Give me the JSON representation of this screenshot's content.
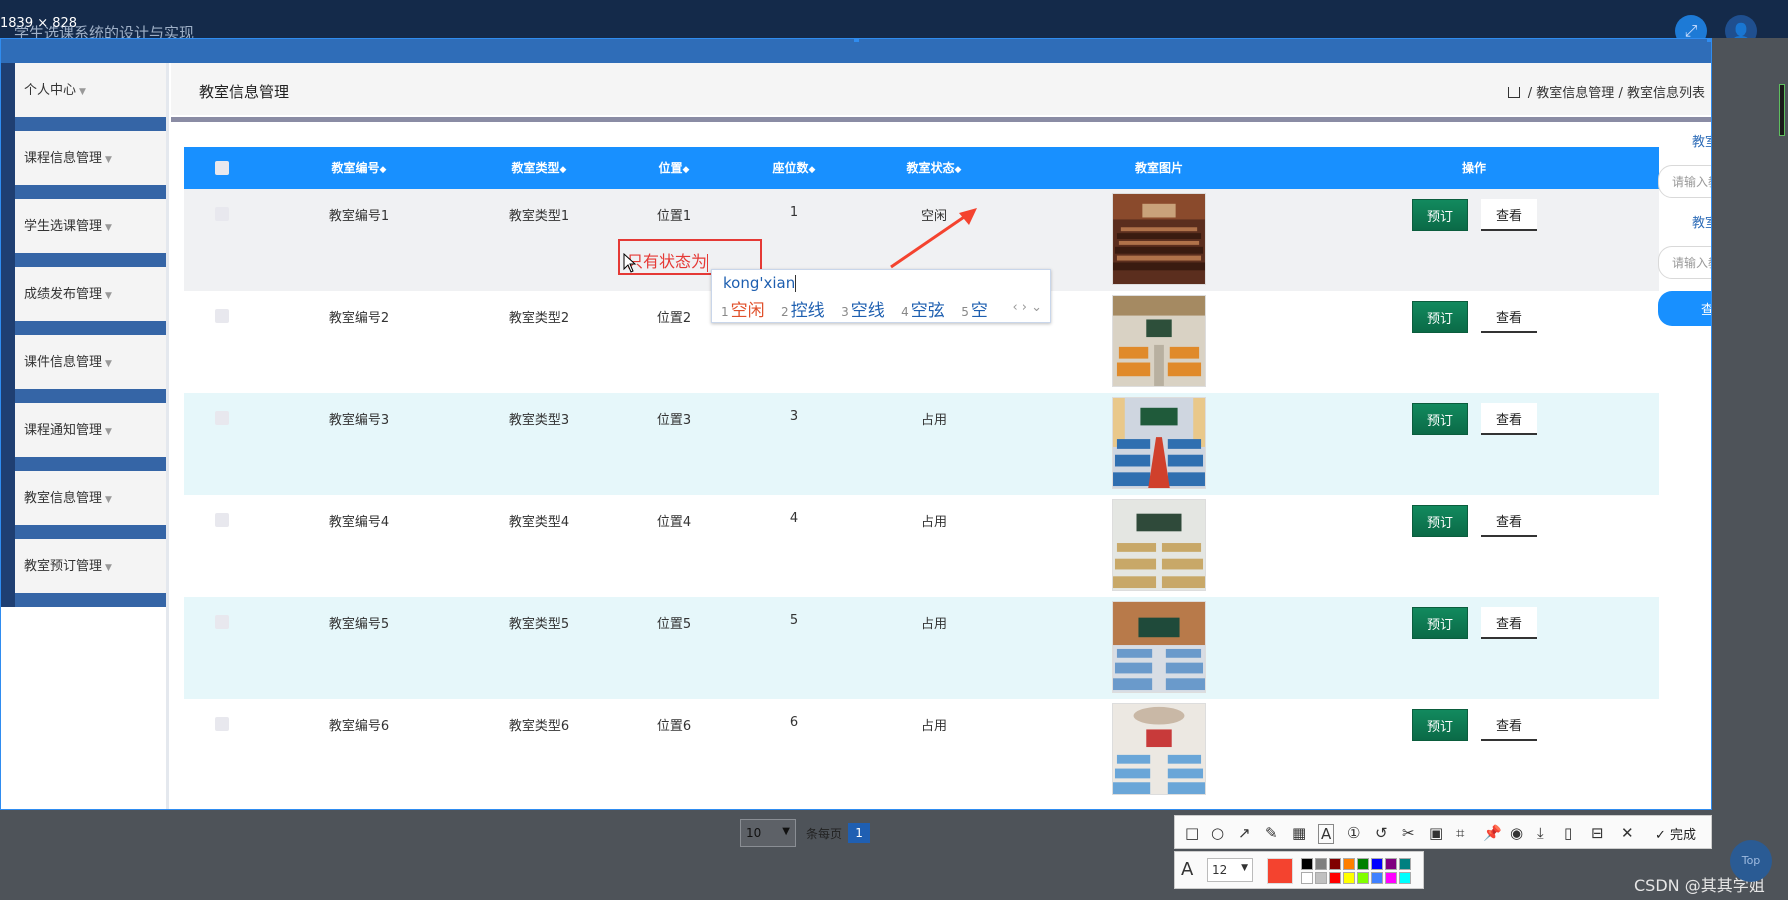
{
  "screen": {
    "size_tag": "1839 × 828",
    "app_title": "学生选课系统的设计与实现"
  },
  "sidebar": {
    "items": [
      {
        "label": "个人中心"
      },
      {
        "label": "课程信息管理"
      },
      {
        "label": "学生选课管理"
      },
      {
        "label": "成绩发布管理"
      },
      {
        "label": "课件信息管理"
      },
      {
        "label": "课程通知管理"
      },
      {
        "label": "教室信息管理"
      },
      {
        "label": "教室预订管理"
      }
    ]
  },
  "header": {
    "page_title": "教室信息管理",
    "breadcrumb": [
      "教室信息管理",
      "教室信息列表"
    ],
    "separator": "/"
  },
  "table": {
    "columns": {
      "code": "教室编号",
      "type": "教室类型",
      "location": "位置",
      "seats": "座位数",
      "status": "教室状态",
      "photo": "教室图片",
      "actions": "操作"
    },
    "sort_glyph": "◆",
    "rows": [
      {
        "code": "教室编号1",
        "type": "教室类型1",
        "location": "位置1",
        "seats": "1",
        "status": "空闲",
        "book": "预订",
        "view": "查看"
      },
      {
        "code": "教室编号2",
        "type": "教室类型2",
        "location": "位置2",
        "seats": "",
        "status": "",
        "book": "预订",
        "view": "查看"
      },
      {
        "code": "教室编号3",
        "type": "教室类型3",
        "location": "位置3",
        "seats": "3",
        "status": "占用",
        "book": "预订",
        "view": "查看"
      },
      {
        "code": "教室编号4",
        "type": "教室类型4",
        "location": "位置4",
        "seats": "4",
        "status": "占用",
        "book": "预订",
        "view": "查看"
      },
      {
        "code": "教室编号5",
        "type": "教室类型5",
        "location": "位置5",
        "seats": "5",
        "status": "占用",
        "book": "预订",
        "view": "查看"
      },
      {
        "code": "教室编号6",
        "type": "教室类型6",
        "location": "位置6",
        "seats": "6",
        "status": "占用",
        "book": "预订",
        "view": "查看"
      }
    ]
  },
  "search": {
    "code_label": "教室编号",
    "code_placeholder": "请输入教室编号",
    "type_label": "教室类型",
    "type_placeholder": "请输入教室类型",
    "query_button": "查询"
  },
  "annotation": {
    "text": "只有状态为",
    "color": "#e53935"
  },
  "ime": {
    "pinyin": "kong'xian",
    "candidates": [
      {
        "num": "1",
        "text": "空闲"
      },
      {
        "num": "2",
        "text": "控线"
      },
      {
        "num": "3",
        "text": "空线"
      },
      {
        "num": "4",
        "text": "空弦"
      },
      {
        "num": "5",
        "text": "空"
      }
    ]
  },
  "pagination": {
    "page_size": "10",
    "per_page_label": "条每页",
    "current_page": "1"
  },
  "screenshot_tool": {
    "done_label": "完成",
    "font_size": "12",
    "current_color": "#f4432f",
    "palette": [
      "#000000",
      "#808080",
      "#800000",
      "#ff8000",
      "#008000",
      "#0000ff",
      "#800080",
      "#008080",
      "#ffffff",
      "#c0c0c0",
      "#ff0000",
      "#ffff00",
      "#80ff00",
      "#4080ff",
      "#ff00ff",
      "#00ffff"
    ]
  },
  "watermark": "CSDN @其其学姐",
  "top_button": "Top",
  "colors": {
    "primary": "#1890ff",
    "sidebar_accent": "#3565a6",
    "book_button": "#0b6a47"
  }
}
